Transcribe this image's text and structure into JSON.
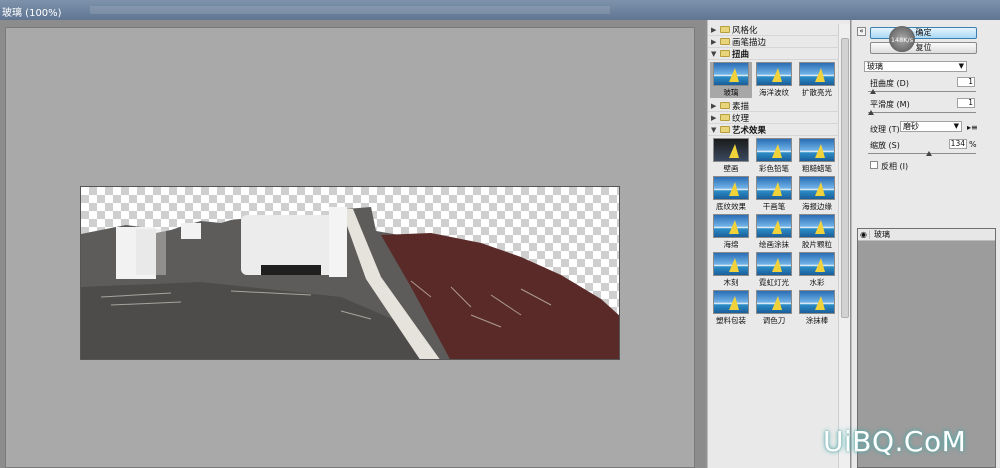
{
  "window": {
    "title": "玻璃 (100%)"
  },
  "gallery": {
    "folders": [
      {
        "label": "风格化",
        "open": false
      },
      {
        "label": "画笔描边",
        "open": false
      },
      {
        "label": "扭曲",
        "open": true
      },
      {
        "label": "素描",
        "open": false
      },
      {
        "label": "纹理",
        "open": false
      },
      {
        "label": "艺术效果",
        "open": true
      }
    ],
    "distort_items": [
      "玻璃",
      "海洋波纹",
      "扩散亮光"
    ],
    "artistic_items": [
      "壁画",
      "彩色铅笔",
      "粗糙蜡笔",
      "底纹效果",
      "干画笔",
      "海报边缘",
      "海绵",
      "绘画涂抹",
      "胶片颗粒",
      "木刻",
      "霓虹灯光",
      "水彩",
      "塑料包装",
      "调色刀",
      "涂抹棒"
    ]
  },
  "settings": {
    "ok_label": "确定",
    "reset_label": "复位",
    "memory": "148K/s",
    "filter_selected": "玻璃",
    "distortion_label": "扭曲度 (D)",
    "distortion_value": "1",
    "smoothness_label": "平滑度 (M)",
    "smoothness_value": "1",
    "texture_label": "纹理 (T):",
    "texture_selected": "磨砂",
    "scaling_label": "缩放 (S)",
    "scaling_value": "134",
    "scaling_unit": "%",
    "invert_label": "反相 (I)",
    "invert_checked": false,
    "layer_name": "玻璃"
  },
  "watermark": "UiBQ.CoM"
}
